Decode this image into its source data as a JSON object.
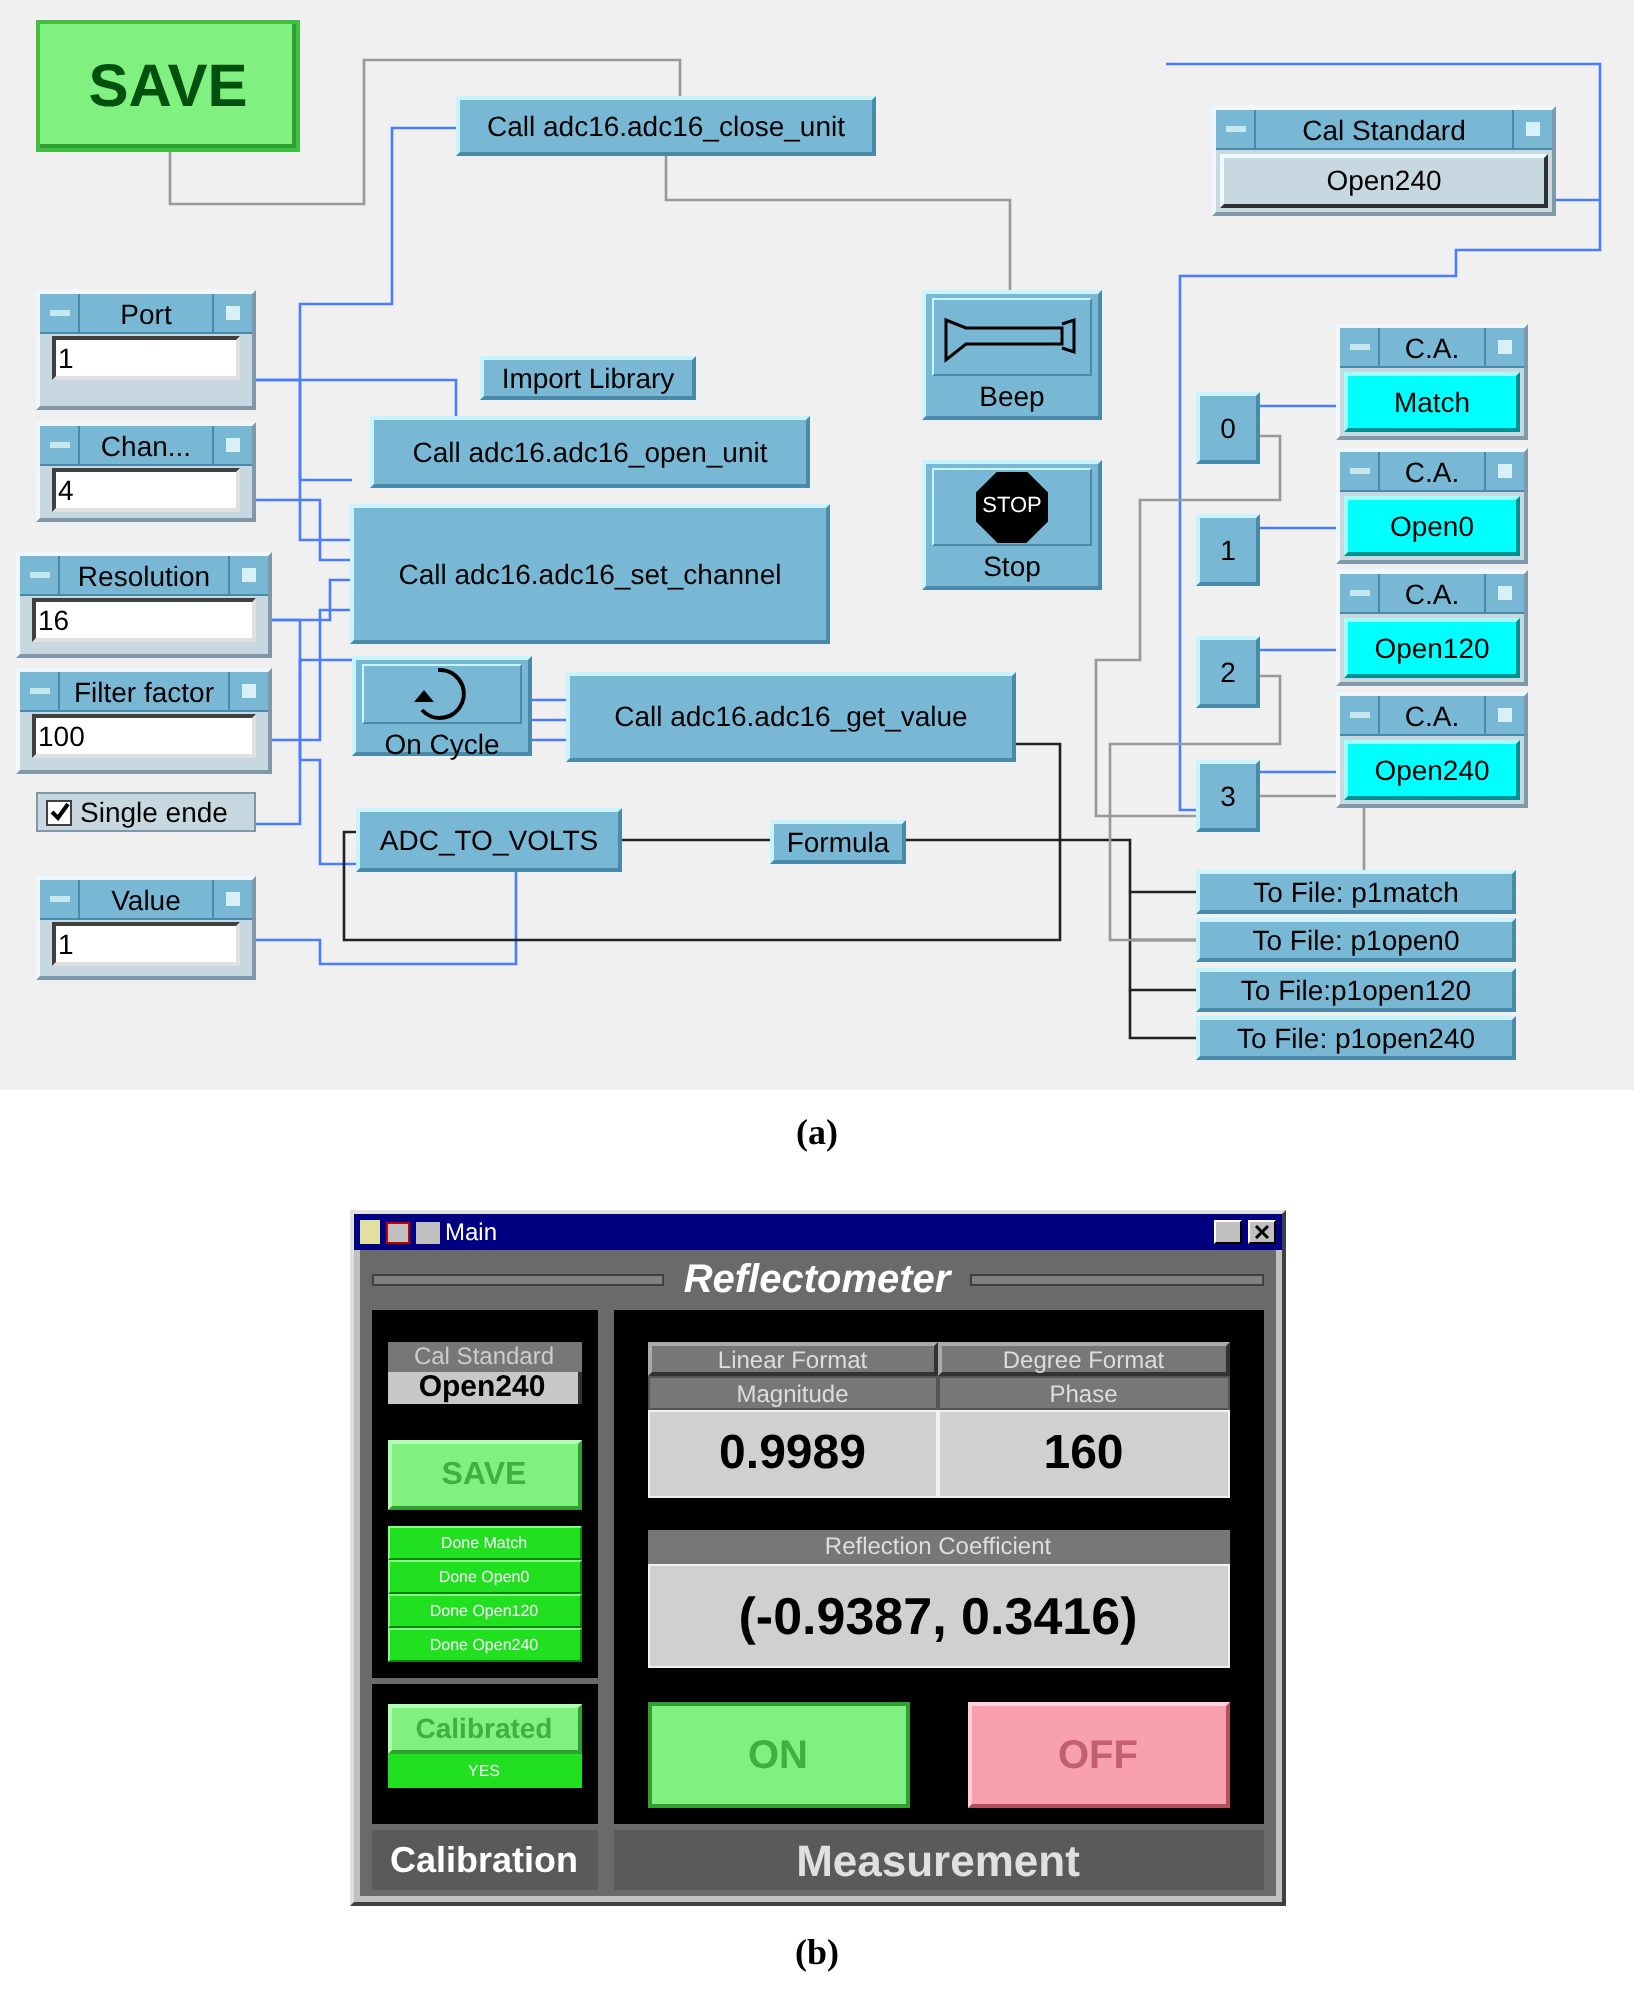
{
  "diagram": {
    "nodes": [
      {
        "kind": "button",
        "label": "SAVE"
      },
      {
        "kind": "call",
        "label": "Call adc16.adc16_close_unit"
      },
      {
        "kind": "input",
        "label": "Port",
        "value": "1"
      },
      {
        "kind": "input",
        "label": "Chan...",
        "value": "4"
      },
      {
        "kind": "input",
        "label": "Resolution",
        "value": "16"
      },
      {
        "kind": "input",
        "label": "Filter factor",
        "value": "100"
      },
      {
        "kind": "checkbox",
        "label": "Single ende",
        "checked": true
      },
      {
        "kind": "input",
        "label": "Value",
        "value": "1"
      },
      {
        "kind": "call",
        "label": "Import Library"
      },
      {
        "kind": "call",
        "label": "Call adc16.adc16_open_unit"
      },
      {
        "kind": "call",
        "label": "Call adc16.adc16_set_channel"
      },
      {
        "kind": "cycle",
        "label": "On Cycle"
      },
      {
        "kind": "call",
        "label": "Call adc16.adc16_get_value"
      },
      {
        "kind": "call",
        "label": "ADC_TO_VOLTS"
      },
      {
        "kind": "call",
        "label": "Formula"
      },
      {
        "kind": "beep",
        "label": "Beep"
      },
      {
        "kind": "stop",
        "label": "Stop",
        "icon_text": "STOP"
      },
      {
        "kind": "enum",
        "label": "Cal Standard",
        "value": "Open240"
      },
      {
        "kind": "number",
        "label": "0"
      },
      {
        "kind": "number",
        "label": "1"
      },
      {
        "kind": "number",
        "label": "2"
      },
      {
        "kind": "number",
        "label": "3"
      },
      {
        "kind": "ca",
        "label": "C.A.",
        "value": "Match"
      },
      {
        "kind": "ca",
        "label": "C.A.",
        "value": "Open0"
      },
      {
        "kind": "ca",
        "label": "C.A.",
        "value": "Open120"
      },
      {
        "kind": "ca",
        "label": "C.A.",
        "value": "Open240"
      },
      {
        "kind": "call",
        "label": "To File: p1match"
      },
      {
        "kind": "call",
        "label": "To File: p1open0"
      },
      {
        "kind": "call",
        "label": "To File:p1open120"
      },
      {
        "kind": "call",
        "label": "To File: p1open240"
      }
    ],
    "caption": "(a)"
  },
  "panel": {
    "window_title": "Main",
    "heading": "Reflectometer",
    "calibration": {
      "cal_label": "Cal Standard",
      "cal_value": "Open240",
      "save": "SAVE",
      "done_buttons": [
        "Done Match",
        "Done Open0",
        "Done Open120",
        "Done Open240"
      ],
      "calibrated": "Calibrated",
      "calibrated_value": "YES",
      "tab": "Calibration"
    },
    "measurement": {
      "format_buttons": [
        "Linear Format",
        "Degree Format"
      ],
      "readouts": [
        {
          "label": "Magnitude",
          "value": "0.9989"
        },
        {
          "label": "Phase",
          "value": "160"
        }
      ],
      "coefficient_label": "Reflection Coefficient",
      "coefficient_value": "(-0.9387, 0.3416)",
      "on": "ON",
      "off": "OFF",
      "tab": "Measurement"
    },
    "caption": "(b)"
  }
}
